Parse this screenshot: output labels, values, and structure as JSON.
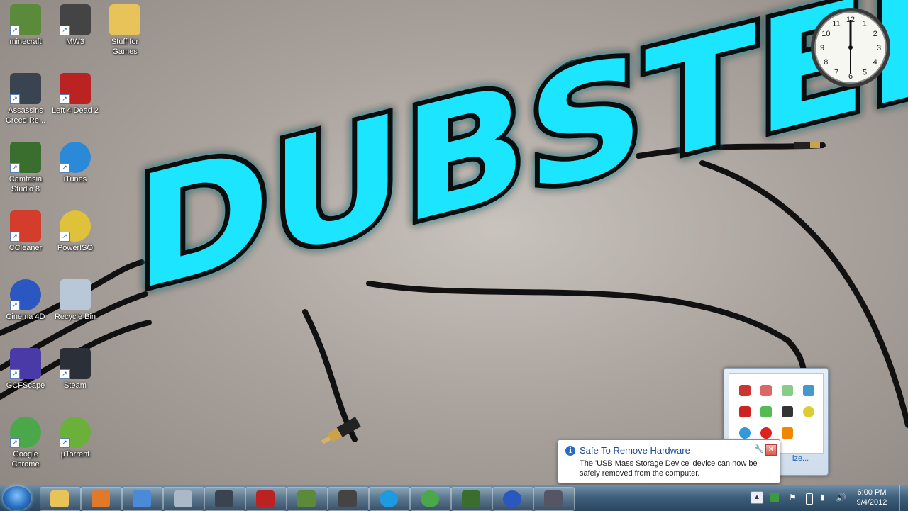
{
  "desktop": {
    "icons": [
      {
        "label": "minecraft",
        "icon": "minecraft-icon"
      },
      {
        "label": "MW3",
        "icon": "mw3-icon"
      },
      {
        "label": "Stuff for Games",
        "icon": "folder-icon"
      },
      {
        "label": "Assassins Creed Re...",
        "icon": "assassins-creed-icon"
      },
      {
        "label": "Left 4 Dead 2",
        "icon": "left4dead2-icon"
      },
      {
        "label": "Camtasia Studio 8",
        "icon": "camtasia-icon"
      },
      {
        "label": "iTunes",
        "icon": "itunes-icon"
      },
      {
        "label": "CCleaner",
        "icon": "ccleaner-icon"
      },
      {
        "label": "PowerISO",
        "icon": "poweriso-icon"
      },
      {
        "label": "Cinema 4D",
        "icon": "cinema4d-icon"
      },
      {
        "label": "Recycle Bin",
        "icon": "recycle-bin-icon"
      },
      {
        "label": "GCFScape",
        "icon": "gcfscape-icon"
      },
      {
        "label": "Steam",
        "icon": "steam-icon"
      },
      {
        "label": "Google Chrome",
        "icon": "chrome-icon"
      },
      {
        "label": "µTorrent",
        "icon": "utorrent-icon"
      }
    ],
    "wallpaper_text": "DUBSTEP"
  },
  "clock_gadget": {
    "numerals": [
      "12",
      "1",
      "2",
      "3",
      "4",
      "5",
      "6",
      "7",
      "8",
      "9",
      "10",
      "11"
    ]
  },
  "taskbar": {
    "pinned": [
      "explorer-icon",
      "media-player-icon",
      "network-icon",
      "calculator-icon",
      "assassins-creed-icon",
      "left4dead2-icon",
      "minecraft-icon",
      "mw3-icon",
      "skype-icon",
      "chrome-icon",
      "camtasia-icon",
      "cinema4d-icon",
      "camtasia-recorder-icon"
    ],
    "time": "6:00 PM",
    "date": "9/4/2012"
  },
  "tray_overflow": {
    "icons": [
      "volume-icon",
      "muted-speaker-icon",
      "sync-icon",
      "network-adapter-icon",
      "adobe-icon",
      "green-app-icon",
      "steam-tray-icon",
      "yellow-app-icon",
      "blue-app-icon",
      "record-icon",
      "orange-app-icon"
    ],
    "customize_label": "ize..."
  },
  "balloon": {
    "title": "Safe To Remove Hardware",
    "message": "The 'USB Mass Storage Device' device can now be safely removed from the computer.",
    "close_label": "✕"
  },
  "colors": {
    "glow": "#1ee6ff",
    "taskbar": "#3f5f7a",
    "balloon_title": "#1e4d8c"
  }
}
